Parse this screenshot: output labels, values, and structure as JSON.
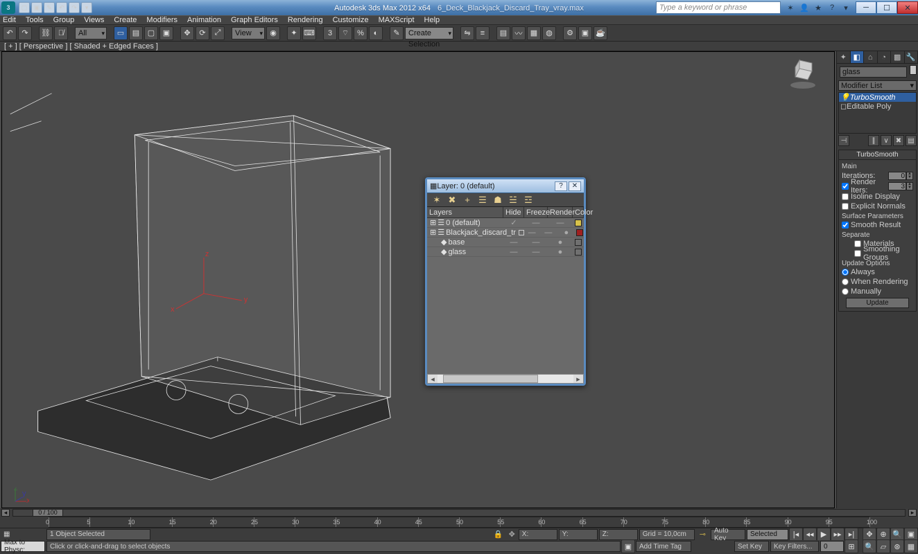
{
  "title": {
    "app": "Autodesk 3ds Max 2012 x64",
    "file": "6_Deck_Blackjack_Discard_Tray_vray.max"
  },
  "menus": [
    "Edit",
    "Tools",
    "Group",
    "Views",
    "Create",
    "Modifiers",
    "Animation",
    "Graph Editors",
    "Rendering",
    "Customize",
    "MAXScript",
    "Help"
  ],
  "toolbar": {
    "dd_all": "All",
    "dd_view": "View",
    "dd_selset": "Create Selection Se"
  },
  "viewport_label": "[ + ] [ Perspective ] [ Shaded + Edged Faces ]",
  "search_placeholder": "Type a keyword or phrase",
  "cmd_panel": {
    "obj_name": "glass",
    "mod_list_label": "Modifier List",
    "stack": [
      {
        "name": "TurboSmooth",
        "sel": true
      },
      {
        "name": "Editable Poly",
        "sel": false
      }
    ],
    "rollout_title": "TurboSmooth",
    "main": "Main",
    "iterations_label": "Iterations:",
    "iterations": "0",
    "render_iters_label": "Render Iters:",
    "render_iters": "3",
    "render_iters_chk": true,
    "isoline": "Isoline Display",
    "isoline_chk": false,
    "explicit": "Explicit Normals",
    "explicit_chk": false,
    "surface": "Surface Parameters",
    "smooth_result": "Smooth Result",
    "smooth_result_chk": true,
    "separate": "Separate",
    "materials": "Materials",
    "materials_chk": false,
    "smoothing_groups": "Smoothing Groups",
    "smoothing_groups_chk": false,
    "update": "Update Options",
    "always": "Always",
    "when_render": "When Rendering",
    "manually": "Manually",
    "update_sel": "always",
    "update_btn": "Update"
  },
  "layer_dlg": {
    "title": "Layer: 0 (default)",
    "cols": [
      "Layers",
      "Hide",
      "Freeze",
      "Render",
      "Color"
    ],
    "rows": [
      {
        "indent": 0,
        "icon": "layers",
        "name": "0 (default)",
        "hide": "✓",
        "freeze": "—",
        "render": "—",
        "color": "#d7c24a"
      },
      {
        "indent": 0,
        "icon": "layers",
        "name": "Blackjack_discard_tr",
        "hide": "—",
        "freeze": "—",
        "render": "●",
        "color": "#a02020",
        "box": true
      },
      {
        "indent": 1,
        "icon": "obj",
        "name": "base",
        "hide": "—",
        "freeze": "—",
        "render": "●",
        "color": "#707070"
      },
      {
        "indent": 1,
        "icon": "obj",
        "name": "glass",
        "hide": "—",
        "freeze": "—",
        "render": "●",
        "color": "#707070"
      }
    ]
  },
  "timeline": {
    "pos": "0 / 100",
    "marks": [
      0,
      5,
      10,
      15,
      20,
      25,
      30,
      35,
      40,
      45,
      50,
      55,
      60,
      65,
      70,
      75,
      80,
      85,
      90,
      95,
      100
    ]
  },
  "status": {
    "sel": "1 Object Selected",
    "x": "X:",
    "y": "Y:",
    "z": "Z:",
    "grid": "Grid = 10,0cm",
    "autokey": "Auto Key",
    "dd": "Selected",
    "setkey": "Set Key",
    "keyfilters": "Key Filters...",
    "script": "Max to Physc:",
    "prompt": "Click or click-and-drag to select objects",
    "addtag": "Add Time Tag"
  }
}
